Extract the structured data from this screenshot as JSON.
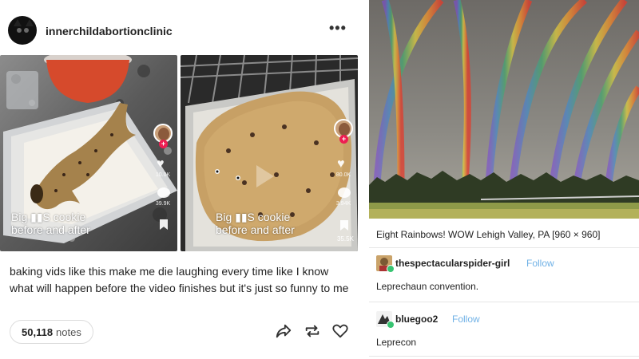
{
  "post": {
    "username": "innerchildabortionclinic",
    "more_label": "•••",
    "videos": [
      {
        "caption_line1": "Big ▮▮S cookie",
        "caption_line2": "before and after",
        "likes": "10.0K",
        "comments": "39.9K"
      },
      {
        "caption_line1": "Big ▮▮S cookie",
        "caption_line2": "before and after",
        "likes": "80.0K",
        "comments": "3.94K",
        "saves": "35.5K"
      }
    ],
    "body_text": "baking vids like this make me die laughing every time like I know what will happen before the video finishes but it's just so funny to me",
    "notes_count": "50,118",
    "notes_label": "notes",
    "actions": [
      {
        "name": "share-icon"
      },
      {
        "name": "reblog-icon"
      },
      {
        "name": "like-icon"
      }
    ]
  },
  "right_post": {
    "image_icon": "rainbow-photo",
    "image_caption": "Eight Rainbows! WOW Lehigh Valley, PA [960 × 960]",
    "reblogs": [
      {
        "username": "thespectacularspider-girl",
        "follow_label": "Follow",
        "text": "Leprechaun convention."
      },
      {
        "username": "bluegoo2",
        "follow_label": "Follow",
        "text": "Leprecon"
      }
    ]
  },
  "colors": {
    "follow": "#6fb1e6",
    "badge": "#38c472",
    "tiktok_red": "#ee1d52"
  }
}
